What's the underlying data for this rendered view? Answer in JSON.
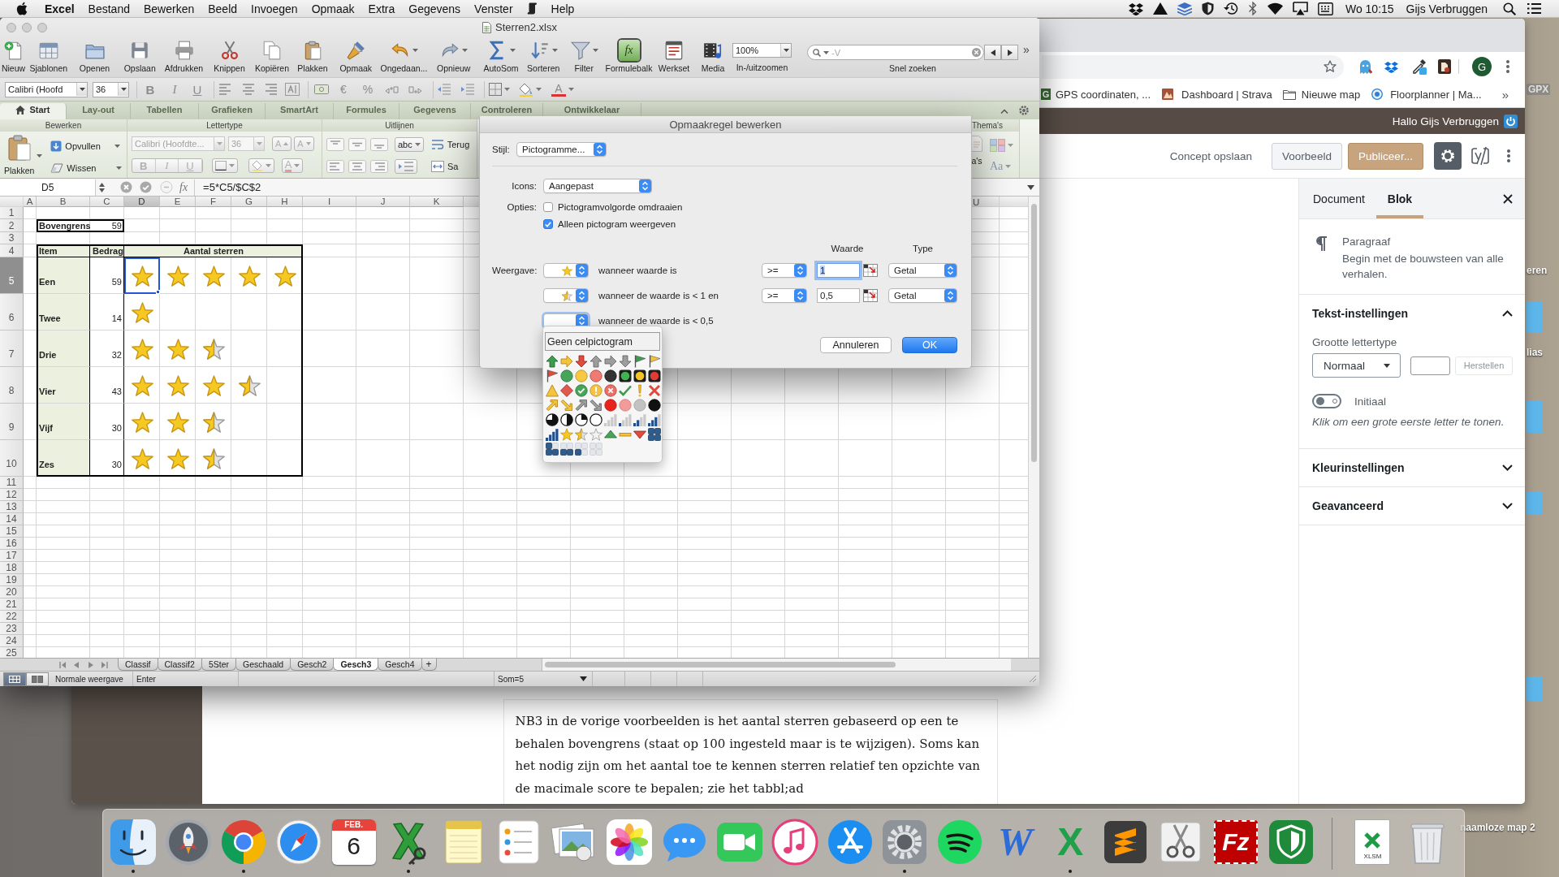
{
  "menubar": {
    "app": "Excel",
    "menus": [
      "Bestand",
      "Bewerken",
      "Beeld",
      "Invoegen",
      "Opmaak",
      "Extra",
      "Gegevens",
      "Venster",
      "Help"
    ],
    "clock": "Wo 10:15",
    "user": "Gijs Verbruggen"
  },
  "excel": {
    "title": "Sterren2.xlsx",
    "toolbar": [
      {
        "kind": "new",
        "label": "Nieuw",
        "selected": false
      },
      {
        "kind": "templates",
        "label": "Sjablonen",
        "selected": false
      },
      {
        "kind": "open",
        "label": "Openen",
        "selected": false
      },
      {
        "kind": "save",
        "label": "Opslaan",
        "selected": false
      },
      {
        "kind": "print",
        "label": "Afdrukken",
        "selected": false
      },
      {
        "kind": "cut",
        "label": "Knippen",
        "selected": false
      },
      {
        "kind": "copy",
        "label": "Kopiëren",
        "selected": false
      },
      {
        "kind": "paste",
        "label": "Plakken",
        "selected": false
      },
      {
        "kind": "format",
        "label": "Opmaak",
        "selected": false
      },
      {
        "kind": "undo",
        "label": "Ongedaan...",
        "selected": false
      },
      {
        "kind": "redo",
        "label": "Opnieuw",
        "selected": false
      },
      {
        "kind": "autosum",
        "label": "AutoSom",
        "selected": false
      },
      {
        "kind": "sort",
        "label": "Sorteren",
        "selected": false
      },
      {
        "kind": "filter",
        "label": "Filter",
        "selected": false
      },
      {
        "kind": "formula",
        "label": "Formulebalk",
        "glyph": "fx",
        "selected": true
      },
      {
        "kind": "toolbox",
        "label": "Werkset",
        "selected": false
      },
      {
        "kind": "media",
        "label": "Media",
        "selected": false
      }
    ],
    "zoom": {
      "value": "100%",
      "label": "In-/uitzoomen"
    },
    "search": {
      "placeholder": "-V",
      "label": "Snel zoeken"
    },
    "overflow": "»",
    "formatbar": {
      "font": "Calibri (Hoofd",
      "size": "36",
      "styles": [
        "B",
        "I",
        "U"
      ],
      "currency": "€",
      "percent": "%",
      "font_color": "A"
    },
    "ribbon": {
      "tabs": [
        {
          "label": "Start",
          "selected": true
        },
        {
          "label": "Lay-out",
          "selected": false
        },
        {
          "label": "Tabellen",
          "selected": false
        },
        {
          "label": "Grafieken",
          "selected": false
        },
        {
          "label": "SmartArt",
          "selected": false
        },
        {
          "label": "Formules",
          "selected": false
        },
        {
          "label": "Gegevens",
          "selected": false
        },
        {
          "label": "Controleren",
          "selected": false
        },
        {
          "label": "Ontwikkelaar",
          "selected": false
        }
      ],
      "groups": [
        "Bewerken",
        "Lettertype",
        "Uitlijnen",
        "Thema's"
      ],
      "edit": {
        "paste": "Plakken",
        "fill": "Opvullen",
        "clear": "Wissen"
      },
      "font_group": {
        "font": "Calibri (Hoofdte...",
        "size": "36",
        "grow": "A",
        "shrink": "A",
        "styles": [
          "B",
          "I",
          "U"
        ],
        "font_color": "A",
        "disabled": true
      },
      "align": {
        "orientation": "abc",
        "wrap": "Terug",
        "merge": "Sa"
      },
      "themes": {
        "button": "a's",
        "fonts": "Aa"
      }
    },
    "formula_bar": {
      "cell": "D5",
      "fx": "fx",
      "formula": "=5*C5/$C$2"
    },
    "columns": [
      {
        "label": "A",
        "selected": false
      },
      {
        "label": "B",
        "selected": false
      },
      {
        "label": "C",
        "selected": false
      },
      {
        "label": "D",
        "selected": true
      },
      {
        "label": "E",
        "selected": false
      },
      {
        "label": "F",
        "selected": false
      },
      {
        "label": "G",
        "selected": false
      },
      {
        "label": "H",
        "selected": false
      },
      {
        "label": "I",
        "selected": false
      },
      {
        "label": "J",
        "selected": false
      },
      {
        "label": "K",
        "selected": false
      }
    ],
    "columns_right": [
      "U"
    ],
    "row_headers": [
      {
        "label": "1",
        "selected": false
      },
      {
        "label": "2",
        "selected": false
      },
      {
        "label": "3",
        "selected": false
      },
      {
        "label": "4",
        "selected": false
      },
      {
        "label": "5",
        "selected": true
      },
      {
        "label": "6",
        "selected": false
      },
      {
        "label": "7",
        "selected": false
      },
      {
        "label": "8",
        "selected": false
      },
      {
        "label": "9",
        "selected": false
      },
      {
        "label": "10",
        "selected": false
      },
      {
        "label": "11",
        "selected": false
      },
      {
        "label": "12",
        "selected": false
      },
      {
        "label": "13",
        "selected": false
      },
      {
        "label": "14",
        "selected": false
      },
      {
        "label": "15",
        "selected": false
      },
      {
        "label": "16",
        "selected": false
      },
      {
        "label": "17",
        "selected": false
      },
      {
        "label": "18",
        "selected": false
      },
      {
        "label": "19",
        "selected": false
      },
      {
        "label": "20",
        "selected": false
      },
      {
        "label": "21",
        "selected": false
      },
      {
        "label": "22",
        "selected": false
      },
      {
        "label": "23",
        "selected": false
      },
      {
        "label": "24",
        "selected": false
      },
      {
        "label": "25",
        "selected": false
      }
    ],
    "limit": {
      "label": "Bovengrens",
      "value": "59"
    },
    "table": {
      "headers": [
        "Item",
        "Bedrag",
        "Aantal sterren"
      ],
      "rows": [
        {
          "item": "Een",
          "amount": "59",
          "cells": [
            {
              "kind": "star"
            },
            {
              "kind": "star"
            },
            {
              "kind": "star"
            },
            {
              "kind": "star"
            },
            {
              "kind": "star"
            }
          ]
        },
        {
          "item": "Twee",
          "amount": "14",
          "cells": [
            {
              "kind": "star"
            }
          ]
        },
        {
          "item": "Drie",
          "amount": "32",
          "cells": [
            {
              "kind": "star"
            },
            {
              "kind": "star"
            },
            {
              "kind": "halfstar"
            }
          ]
        },
        {
          "item": "Vier",
          "amount": "43",
          "cells": [
            {
              "kind": "star"
            },
            {
              "kind": "star"
            },
            {
              "kind": "star"
            },
            {
              "kind": "halfstar"
            }
          ]
        },
        {
          "item": "Vijf",
          "amount": "30",
          "cells": [
            {
              "kind": "star"
            },
            {
              "kind": "star"
            },
            {
              "kind": "halfstar"
            }
          ]
        },
        {
          "item": "Zes",
          "amount": "30",
          "cells": [
            {
              "kind": "star"
            },
            {
              "kind": "star"
            },
            {
              "kind": "halfstar"
            }
          ]
        }
      ]
    },
    "views": [
      {
        "kind": "normal",
        "selected": true
      },
      {
        "kind": "layout",
        "selected": false
      }
    ],
    "sheets": [
      {
        "label": "Classif",
        "selected": false
      },
      {
        "label": "Classif2",
        "selected": false
      },
      {
        "label": "5Ster",
        "selected": false
      },
      {
        "label": "Geschaald",
        "selected": false
      },
      {
        "label": "Gesch2",
        "selected": false
      },
      {
        "label": "Gesch3",
        "selected": true
      },
      {
        "label": "Gesch4",
        "selected": false
      }
    ],
    "add_sheet": "+",
    "status": {
      "view": "Normale weergave",
      "mode": "Enter",
      "sum": "Som=5"
    }
  },
  "dialog": {
    "title": "Opmaakregel bewerken",
    "style": {
      "label": "Stijl:",
      "value": "Pictogramme..."
    },
    "icons": {
      "label": "Icons:",
      "value": "Aangepast"
    },
    "options_label": "Opties:",
    "options": [
      {
        "label": "Pictogramvolgorde omdraaien",
        "checked": false
      },
      {
        "label": "Alleen pictogram weergeven",
        "checked": true
      }
    ],
    "headers": [
      "Waarde",
      "Type"
    ],
    "display_label": "Weergave:",
    "rules": [
      {
        "kind": "star",
        "text": "wanneer waarde is",
        "operator": ">=",
        "value": "1",
        "type": "Getal",
        "focused": true,
        "expanded": false
      },
      {
        "kind": "halfstar",
        "text": "wanneer de waarde is < 1 en",
        "operator": ">=",
        "value": "0,5",
        "type": "Getal",
        "focused": false,
        "expanded": false
      },
      {
        "kind": "blank",
        "text": "wanneer de waarde is < 0,5",
        "expanded": true
      }
    ],
    "buttons": [
      {
        "label": "Annuleren",
        "default": false
      },
      {
        "label": "OK",
        "default": true
      }
    ],
    "picker": {
      "none_label": "Geen celpictogram"
    }
  },
  "browser": {
    "bookmarks": [
      {
        "kind": "letter",
        "favicon": "G",
        "label": "GPS coordinaten, ..."
      },
      {
        "kind": "tile",
        "label": "Dashboard | Strava"
      },
      {
        "kind": "folder",
        "label": "Nieuwe map"
      },
      {
        "kind": "globe",
        "label": "Floorplanner | Ma..."
      }
    ],
    "bookmarks_more": "»",
    "avatar": "G",
    "admin_greeting": "Hallo Gijs Verbruggen",
    "editor": {
      "save_draft": "Concept opslaan",
      "preview": "Voorbeeld",
      "publish": "Publiceer...",
      "settings_selected": true,
      "paragraph": "NB3 in de vorige voorbeelden is het aantal sterren gebaseerd op een te behalen bovengrens (staat op 100 ingesteld maar is te wijzigen). Soms kan het nodig zijn om het aantal toe te kennen sterren relatief ten opzichte van de macimale score te bepalen; zie het tabbl;ad"
    },
    "sidebar": {
      "tabs": [
        {
          "label": "Document",
          "selected": false
        },
        {
          "label": "Blok",
          "selected": true
        }
      ],
      "block": {
        "title": "Paragraaf",
        "description": "Begin met de bouwsteen van alle verhalen."
      },
      "panels": [
        {
          "title": "Tekst-instellingen",
          "expanded": true,
          "font_size_label": "Grootte lettertype",
          "font_size": "Normaal",
          "reset": "Herstellen",
          "reset_disabled": true,
          "drop_cap": "Initiaal",
          "drop_cap_on": false,
          "drop_cap_help": "Klik om een grote eerste letter te tonen."
        },
        {
          "title": "Kleurinstellingen",
          "expanded": false
        },
        {
          "title": "Geavanceerd",
          "expanded": false
        }
      ]
    }
  },
  "dock": [
    {
      "kind": "finder",
      "running": true
    },
    {
      "kind": "launchpad",
      "running": false
    },
    {
      "kind": "chrome",
      "running": true
    },
    {
      "kind": "safari",
      "running": false
    },
    {
      "kind": "calendar",
      "month": "FEB.",
      "day": "6",
      "running": false
    },
    {
      "kind": "xkey",
      "running": true
    },
    {
      "kind": "notes",
      "running": false
    },
    {
      "kind": "reminders",
      "running": false
    },
    {
      "kind": "preview",
      "running": false
    },
    {
      "kind": "photos",
      "running": false
    },
    {
      "kind": "messages",
      "running": false
    },
    {
      "kind": "facetime",
      "running": false
    },
    {
      "kind": "music",
      "running": false
    },
    {
      "kind": "appstore",
      "running": false
    },
    {
      "kind": "prefs",
      "running": true
    },
    {
      "kind": "spotify",
      "running": false
    },
    {
      "kind": "word",
      "label": "W",
      "running": false
    },
    {
      "kind": "excel",
      "label": "X",
      "running": true
    },
    {
      "kind": "sublime",
      "running": false
    },
    {
      "kind": "scissors",
      "running": false
    },
    {
      "kind": "filezilla",
      "label": "Fz",
      "running": false
    },
    {
      "kind": "shield",
      "running": false
    },
    {
      "kind": "separator"
    },
    {
      "kind": "file",
      "label": "XLSM"
    },
    {
      "kind": "trash"
    }
  ],
  "desktop": [
    {
      "label": "GPX"
    },
    {
      "label": "eren"
    },
    {
      "label": "lias"
    },
    {
      "label": "naamloze map 2"
    }
  ]
}
